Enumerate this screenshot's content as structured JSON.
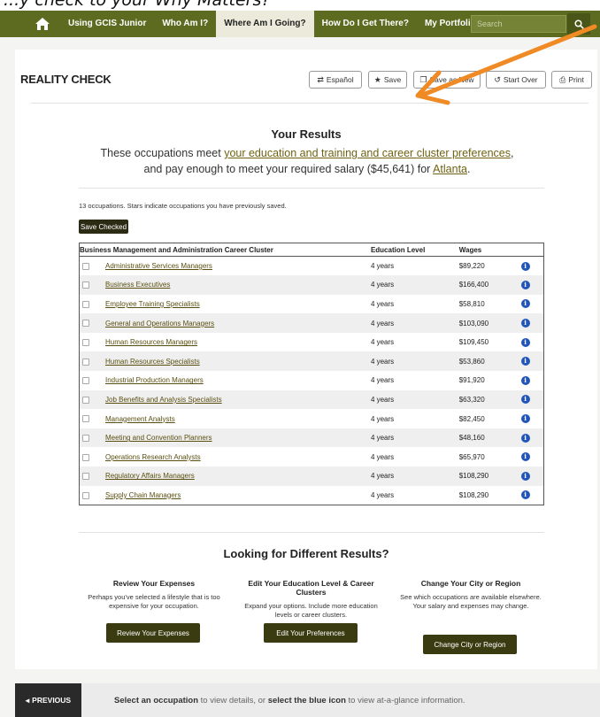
{
  "caption_fragment": "...y check to your Why Matters?",
  "nav": {
    "items": [
      "Using GCIS Junior",
      "Who Am I?",
      "Where Am I Going?",
      "How Do I Get There?",
      "My Portfolio"
    ],
    "active_index": 2,
    "search_placeholder": "Search"
  },
  "header": {
    "title": "REALITY CHECK",
    "buttons": {
      "espanol": "Español",
      "save": "Save",
      "save_as_new": "Save as New",
      "start_over": "Start Over",
      "print": "Print"
    }
  },
  "results": {
    "heading": "Your Results",
    "text_before": "These occupations meet ",
    "link_prefs": "your education and training and career cluster preferences",
    "text_middle": ", and pay enough to meet your required salary ($45,641) for ",
    "link_city": "Atlanta",
    "text_end": ".",
    "count_text": "13 occupations. Stars indicate occupations you have previously saved.",
    "save_checked": "Save Checked"
  },
  "table": {
    "headers": [
      "Business Management and Administration Career Cluster",
      "Education Level",
      "Wages"
    ],
    "rows": [
      {
        "name": "Administrative Services Managers",
        "edu": "4 years",
        "wage": "$89,220"
      },
      {
        "name": "Business Executives",
        "edu": "4 years",
        "wage": "$166,400"
      },
      {
        "name": "Employee Training Specialists",
        "edu": "4 years",
        "wage": "$58,810"
      },
      {
        "name": "General and Operations Managers",
        "edu": "4 years",
        "wage": "$103,090"
      },
      {
        "name": "Human Resources Managers",
        "edu": "4 years",
        "wage": "$109,450"
      },
      {
        "name": "Human Resources Specialists",
        "edu": "4 years",
        "wage": "$53,860"
      },
      {
        "name": "Industrial Production Managers",
        "edu": "4 years",
        "wage": "$91,920"
      },
      {
        "name": "Job Benefits and Analysis Specialists",
        "edu": "4 years",
        "wage": "$63,320"
      },
      {
        "name": "Management Analysts",
        "edu": "4 years",
        "wage": "$82,450"
      },
      {
        "name": "Meeting and Convention Planners",
        "edu": "4 years",
        "wage": "$48,160"
      },
      {
        "name": "Operations Research Analysts",
        "edu": "4 years",
        "wage": "$65,970"
      },
      {
        "name": "Regulatory Affairs Managers",
        "edu": "4 years",
        "wage": "$108,290"
      },
      {
        "name": "Supply Chain Managers",
        "edu": "4 years",
        "wage": "$108,290"
      }
    ]
  },
  "different": {
    "heading": "Looking for Different Results?",
    "expenses": {
      "title": "Review Your Expenses",
      "text": "Perhaps you've selected a lifestyle that is too expensive for your occupation.",
      "button": "Review Your Expenses"
    },
    "edu": {
      "title": "Edit Your Education Level & Career Clusters",
      "text": "Expand your options. Include more education levels or career clusters.",
      "button": "Edit Your Preferences"
    },
    "city": {
      "title": "Change Your City or Region",
      "text": "See which occupations are available elsewhere. Your salary and expenses may change.",
      "button": "Change City or Region"
    }
  },
  "footer": {
    "previous": "PREVIOUS",
    "hint_bold1": "Select an occupation",
    "hint_mid": " to view details, or ",
    "hint_bold2": "select the blue icon",
    "hint_end": " to view at-a-glance information."
  },
  "colors": {
    "nav_bg": "#5d6b20",
    "arrow": "#f08a24",
    "info_icon": "#2255bb",
    "button_dark": "#3b3b12"
  }
}
